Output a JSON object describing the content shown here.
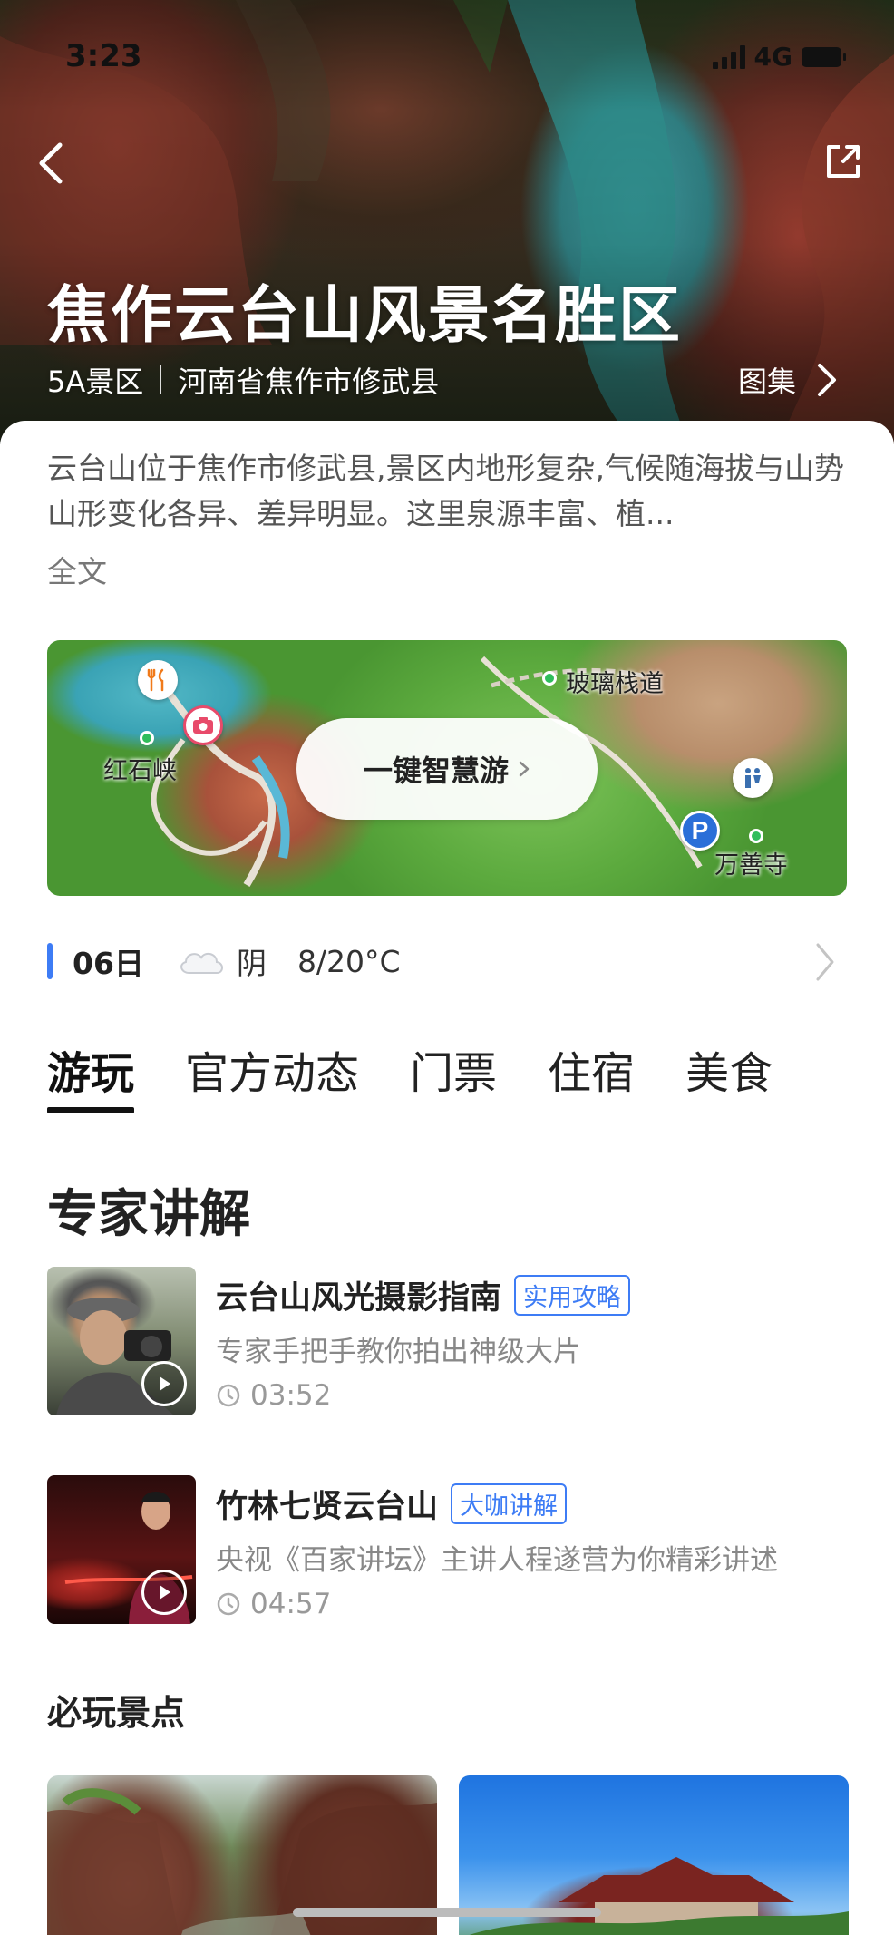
{
  "status_bar": {
    "time": "3:23",
    "network": "4G"
  },
  "hero": {
    "title": "焦作云台山风景名胜区",
    "level": "5A景区",
    "location": "河南省焦作市修武县",
    "gallery_label": "图集"
  },
  "description": {
    "text": "云台山位于焦作市修武县,景区内地形复杂,气候随海拔与山势山形变化各异、差异明显。这里泉源丰富、植...",
    "more_label": "全文"
  },
  "map": {
    "cta_label": "一键智慧游",
    "labels": {
      "glass_walkway": "玻璃栈道",
      "red_stone_gorge": "红石峡",
      "wanshan_temple": "万善寺"
    }
  },
  "weather": {
    "date": "06日",
    "condition": "阴",
    "temperature": "8/20°C"
  },
  "tabs": [
    {
      "label": "游玩",
      "active": true
    },
    {
      "label": "官方动态",
      "active": false
    },
    {
      "label": "门票",
      "active": false
    },
    {
      "label": "住宿",
      "active": false
    },
    {
      "label": "美食",
      "active": false
    }
  ],
  "expert_section": {
    "title": "专家讲解",
    "items": [
      {
        "title": "云台山风光摄影指南",
        "tag": "实用攻略",
        "subtitle": "专家手把手教你拍出神级大片",
        "duration": "03:52"
      },
      {
        "title": "竹林七贤云台山",
        "tag": "大咖讲解",
        "subtitle": "央视《百家讲坛》主讲人程遂营为你精彩讲述",
        "duration": "04:57"
      }
    ]
  },
  "must_see": {
    "title": "必玩景点"
  },
  "colors": {
    "accent": "#3d7cf5",
    "text_primary": "#222222",
    "text_secondary": "#888888"
  }
}
